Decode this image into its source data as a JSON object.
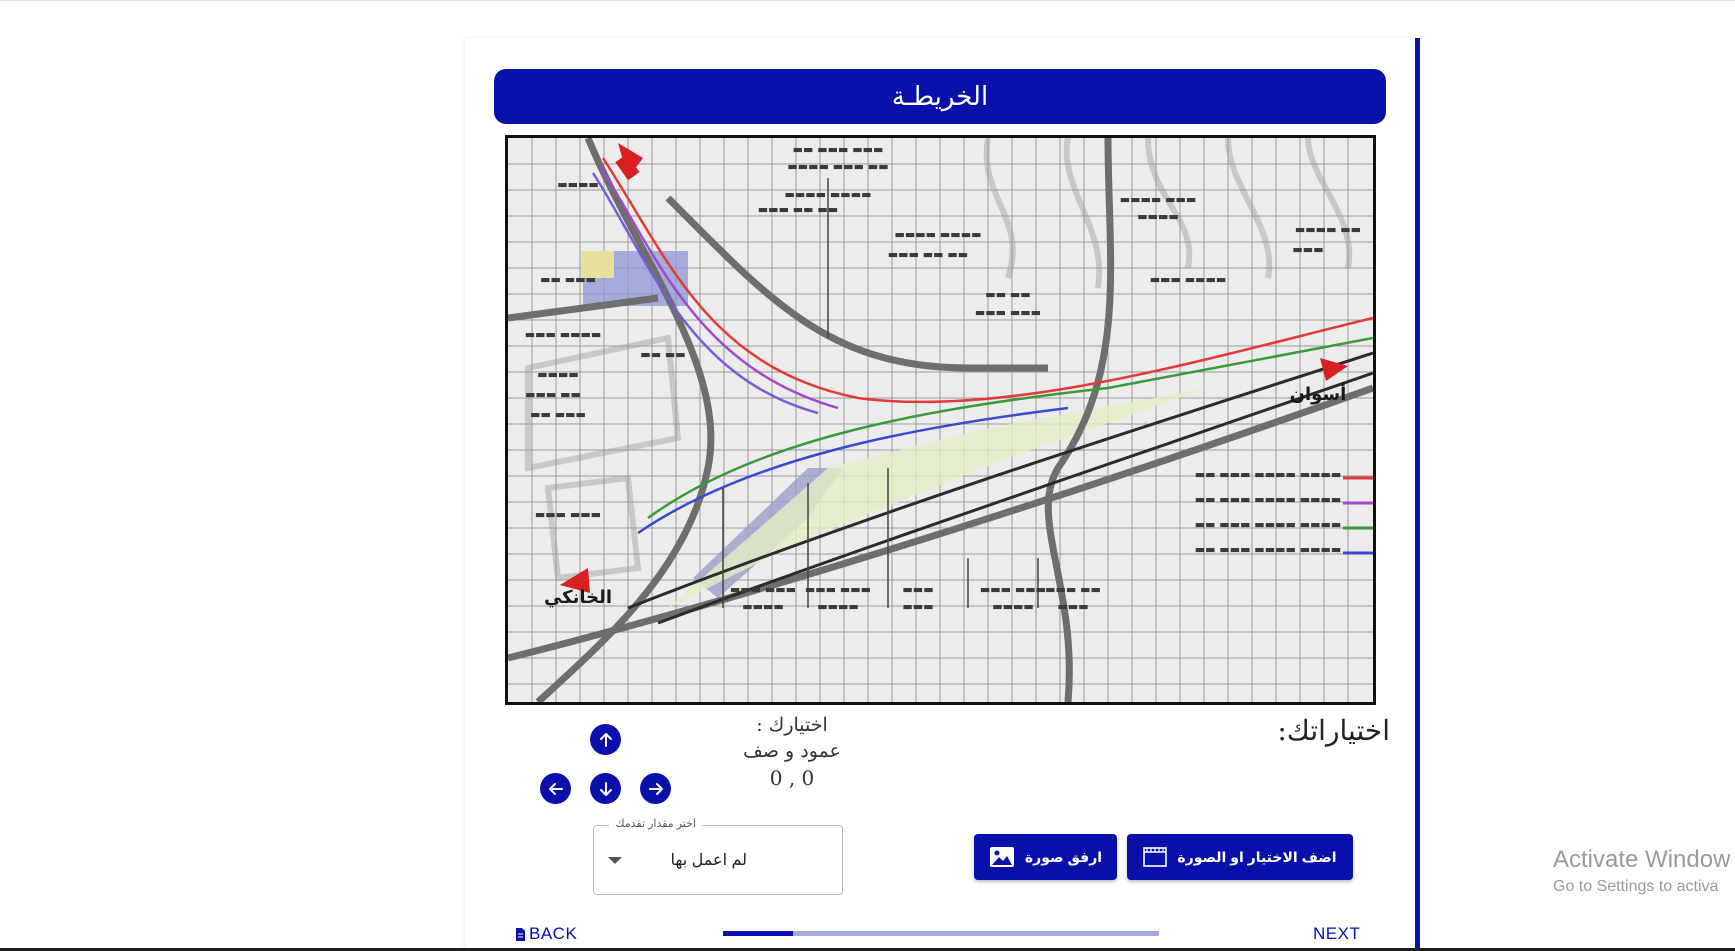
{
  "header": {
    "title": "الخريطـة"
  },
  "selection": {
    "choices_label": "اختياراتك:",
    "your_choice_label": "اختيارك :",
    "column_row_label": "عمود و صف",
    "coordinates": "0 , 0"
  },
  "progress_dropdown": {
    "legend": "اختر مقدار تقدمك",
    "selected": "لم اعمل بها"
  },
  "buttons": {
    "add_choice": "اضف الاختيار او الصورة",
    "attach_image": "ارفق صورة"
  },
  "nav": {
    "back": "BACK",
    "next": "NEXT",
    "progress_fraction": 0.16
  },
  "watermark": {
    "line1": "Activate Window",
    "line2": "Go to Settings to activa"
  },
  "map_labels": {
    "aswan": "أسوان",
    "khanka": "الخانكي"
  },
  "colors": {
    "primary": "#0a10aa",
    "progress_track": "#a6aadf"
  }
}
